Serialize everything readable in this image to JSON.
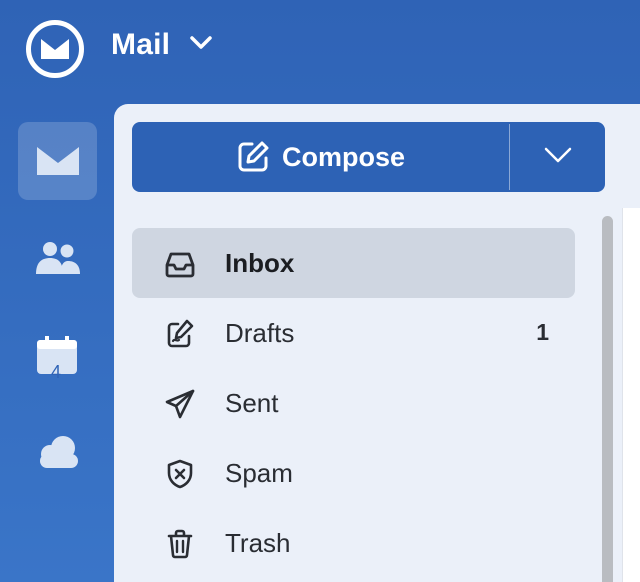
{
  "header": {
    "app_title": "Mail",
    "logo_icon": "mail-logo-icon",
    "menu_icon": "chevron-down-icon"
  },
  "rail": {
    "items": [
      {
        "id": "mail",
        "icon": "mail-icon",
        "active": true
      },
      {
        "id": "contacts",
        "icon": "contacts-icon",
        "active": false
      },
      {
        "id": "calendar",
        "icon": "calendar-icon",
        "day": "4",
        "active": false
      },
      {
        "id": "cloud",
        "icon": "cloud-icon",
        "active": false
      }
    ]
  },
  "compose": {
    "label": "Compose",
    "icon": "edit-icon",
    "dropdown_icon": "chevron-down-icon"
  },
  "folders": [
    {
      "label": "Inbox",
      "icon": "inbox-icon",
      "count": "",
      "active": true
    },
    {
      "label": "Drafts",
      "icon": "draft-icon",
      "count": "1",
      "active": false
    },
    {
      "label": "Sent",
      "icon": "send-icon",
      "count": "",
      "active": false
    },
    {
      "label": "Spam",
      "icon": "spam-shield-icon",
      "count": "",
      "active": false
    },
    {
      "label": "Trash",
      "icon": "trash-icon",
      "count": "",
      "active": false
    }
  ],
  "colors": {
    "brand": "#2f63b6",
    "compose_bg": "#2d62b5",
    "panel_bg": "#ebf0f9",
    "active_folder_bg": "#cfd6e1"
  }
}
